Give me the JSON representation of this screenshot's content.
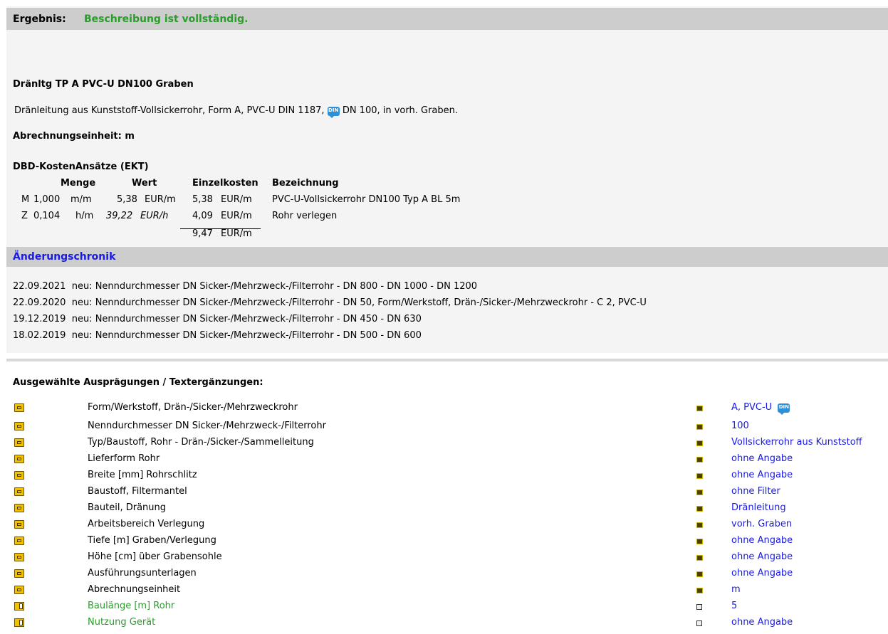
{
  "result": {
    "label": "Ergebnis:",
    "value": "Beschreibung ist vollständig."
  },
  "position": {
    "short_text": "Dränltg TP A PVC-U DN100 Graben",
    "long_text_prefix": "Dränleitung aus Kunststoff-Vollsickerrohr, Form A, PVC-U DIN 1187,",
    "din_badge": "DIN",
    "long_text_suffix": "DN 100, in vorh. Graben.",
    "unit_line": "Abrechnungseinheit: m"
  },
  "costs": {
    "title": "DBD-KostenAnsätze (EKT)",
    "headers": {
      "menge": "Menge",
      "wert": "Wert",
      "einzelkosten": "Einzelkosten",
      "bezeichnung": "Bezeichnung"
    },
    "rows": [
      {
        "typ": "M",
        "menge": "1,000",
        "menge_einheit": "m/m",
        "wert": "5,38",
        "wert_einheit": "EUR/m",
        "einzel": "5,38",
        "einzel_einheit": "EUR/m",
        "bezeichnung": "PVC-U-Vollsickerrohr DN100 Typ A BL 5m"
      },
      {
        "typ": "Z",
        "menge": "0,104",
        "menge_einheit": "h/m",
        "wert": "39,22",
        "wert_einheit": "EUR/h",
        "einzel": "4,09",
        "einzel_einheit": "EUR/m",
        "bezeichnung": "Rohr verlegen"
      }
    ],
    "total": "9,47",
    "total_einheit": "EUR/m"
  },
  "chronik": {
    "title": "Änderungschronik",
    "entries": [
      {
        "date": "22.09.2021",
        "text": "neu: Nenndurchmesser DN Sicker-/Mehrzweck-/Filterrohr - DN 800 - DN 1000 - DN 1200"
      },
      {
        "date": "22.09.2020",
        "text": "neu: Nenndurchmesser DN Sicker-/Mehrzweck-/Filterrohr - DN 50, Form/Werkstoff, Drän-/Sicker-/Mehrzweckrohr - C 2, PVC-U"
      },
      {
        "date": "19.12.2019",
        "text": "neu: Nenndurchmesser DN Sicker-/Mehrzweck-/Filterrohr - DN 450 - DN 630"
      },
      {
        "date": "18.02.2019",
        "text": "neu: Nenndurchmesser DN Sicker-/Mehrzweck-/Filterrohr - DN 500 - DN 600"
      }
    ]
  },
  "selection": {
    "title": "Ausgewählte Ausprägungen / Textergänzungen:",
    "items": [
      {
        "label": "Form/Werkstoff, Drän-/Sicker-/Mehrzweckrohr",
        "value": "A, PVC-U",
        "din": "DIN",
        "icon": "folder-icon",
        "marker": "selection-marker-icon",
        "green": false
      },
      {
        "label": "Nenndurchmesser DN Sicker-/Mehrzweck-/Filterrohr",
        "value": "100",
        "icon": "folder-icon",
        "marker": "selection-marker-icon",
        "green": false
      },
      {
        "label": "Typ/Baustoff, Rohr - Drän-/Sicker-/Sammelleitung",
        "value": "Vollsickerrohr aus Kunststoff",
        "icon": "folder-icon",
        "marker": "selection-marker-icon",
        "green": false
      },
      {
        "label": "Lieferform Rohr",
        "value": "ohne Angabe",
        "icon": "folder-icon",
        "marker": "selection-marker-icon",
        "green": false
      },
      {
        "label": "Breite [mm] Rohrschlitz",
        "value": "ohne Angabe",
        "icon": "folder-icon",
        "marker": "selection-marker-icon",
        "green": false
      },
      {
        "label": "Baustoff, Filtermantel",
        "value": "ohne Filter",
        "icon": "folder-icon",
        "marker": "selection-marker-icon",
        "green": false
      },
      {
        "label": "Bauteil, Dränung",
        "value": "Dränleitung",
        "icon": "folder-icon",
        "marker": "selection-marker-icon",
        "green": false
      },
      {
        "label": "Arbeitsbereich Verlegung",
        "value": "vorh. Graben",
        "icon": "folder-icon",
        "marker": "selection-marker-icon",
        "green": false
      },
      {
        "label": "Tiefe [m] Graben/Verlegung",
        "value": "ohne Angabe",
        "icon": "folder-icon",
        "marker": "selection-marker-icon",
        "green": false
      },
      {
        "label": "Höhe [cm] über Grabensohle",
        "value": "ohne Angabe",
        "icon": "folder-icon",
        "marker": "selection-marker-icon",
        "green": false
      },
      {
        "label": "Ausführungsunterlagen",
        "value": "ohne Angabe",
        "icon": "folder-icon",
        "marker": "selection-marker-icon",
        "green": false
      },
      {
        "label": "Abrechnungseinheit",
        "value": "m",
        "icon": "folder-icon",
        "marker": "selection-marker-icon",
        "green": false
      },
      {
        "label": "Baulänge [m] Rohr",
        "value": "5",
        "icon": "note-icon",
        "marker": "document-icon",
        "green": true
      },
      {
        "label": "Nutzung Gerät",
        "value": "ohne Angabe",
        "icon": "note-icon",
        "marker": "document-icon",
        "green": true
      }
    ]
  }
}
